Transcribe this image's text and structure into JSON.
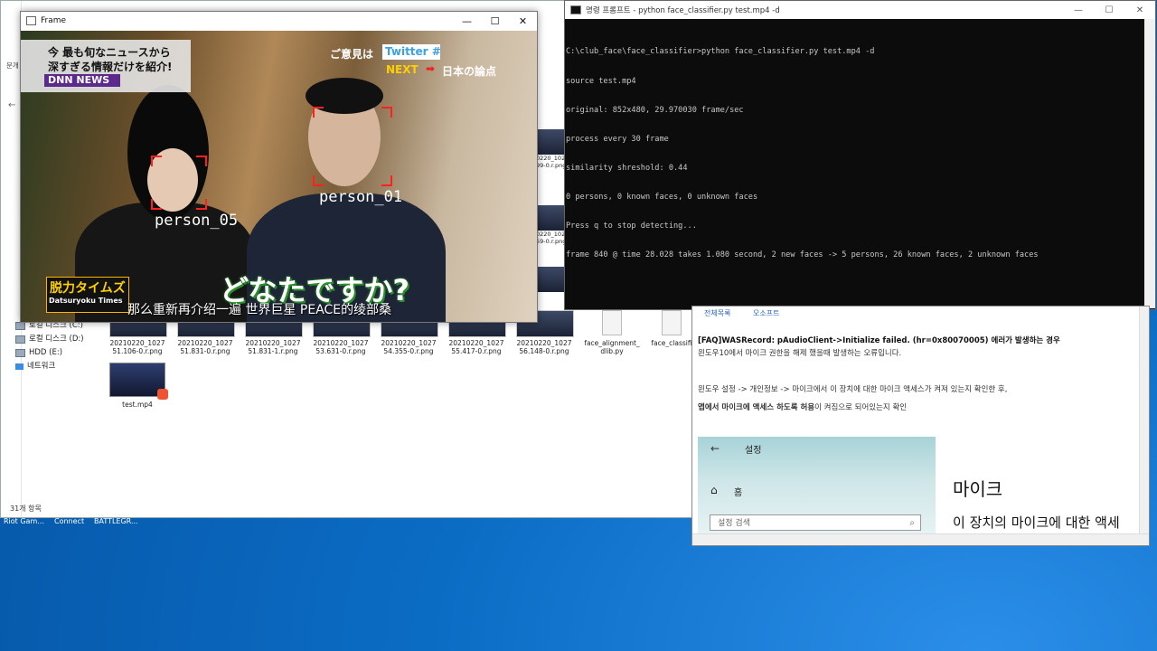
{
  "explorer": {
    "status": "31개 항목",
    "tree": [
      {
        "label": "로컬 디스크 (C:)",
        "icon": "drive-icon"
      },
      {
        "label": "로컬 디스크 (D:)",
        "icon": "drive-icon"
      },
      {
        "label": "HDD (E:)",
        "icon": "drive-icon"
      },
      {
        "label": "네트워크",
        "icon": "network-icon"
      }
    ],
    "files": [
      {
        "name": "20210220_1027\n51.106-0.r.png"
      },
      {
        "name": "20210220_1027\n51.831-0.r.png"
      },
      {
        "name": "20210220_1027\n51.831-1.r.png"
      },
      {
        "name": "20210220_1027\n53.631-0.r.png"
      },
      {
        "name": "20210220_1027\n54.355-0.r.png"
      },
      {
        "name": "20210220_1027\n55.417-0.r.png"
      },
      {
        "name": "20210220_1027\n56.148-0.r.png"
      },
      {
        "name": "face_alignment_\ndlib.py"
      },
      {
        "name": "face_classifi"
      }
    ],
    "video_file": "test.mp4",
    "side_labels": [
      "0220_102\n99-0.r.png",
      "0220_102\n59-0.r.png"
    ],
    "top_left_label": "문개",
    "taskbar": [
      "Riot Gam...",
      "Connect",
      "BATTLEGR..."
    ]
  },
  "frame_window": {
    "title": "Frame",
    "persons": [
      "person_05",
      "person_01"
    ],
    "overlay": {
      "top_left_1": "今 最も旬なニュースから",
      "top_left_2": "深すぎる情報だけを紹介!",
      "brand": "DNN NEWS",
      "opinion": "ご意見は",
      "twitter": "Twitter #",
      "next": "NEXT",
      "next_arrow": "➡",
      "next_text": "日本の論点",
      "logo": "脱力タイムズ",
      "logo_sub": "Datsuryoku Times",
      "caption": "どなたですか?",
      "subtitle": "那么重新再介绍一遍 世界巨星 PEACE的绫部桑"
    }
  },
  "cmd_window": {
    "title": "명령 프롬프트 - python  face_classifier.py test.mp4 -d",
    "lines": [
      "C:\\club_face\\face_classifier>python face_classifier.py test.mp4 -d",
      "source test.mp4",
      "original: 852x480, 29.970030 frame/sec",
      "process every 30 frame",
      "similarity shreshold: 0.44",
      "0 persons, 0 known faces, 0 unknown faces",
      "Press q to stop detecting...",
      "frame 840 @ time 28.028 takes 1.080 second, 2 new faces -> 5 persons, 26 known faces, 2 unknown faces"
    ]
  },
  "web_panel": {
    "tabs": [
      "전체목록",
      "오소프트"
    ],
    "heading": "[FAQ]WASRecord: pAudioClient->Initialize failed. (hr=0x80070005) 에러가 발생하는 경우",
    "line1": "윈도우10에서 마이크 권한을 해제 했을때 발생하는 오류입니다.",
    "line2": "윈도우 설정 -> 개인정보 -> 마이크에서 이 장치에 대한 마이크 액세스가 켜져 있는지 확인한 후,",
    "line3_bold": "앱에서 마이크에 액세스 하도록 허용",
    "line3_rest": "이 켜짐으로 되어있는지 확인",
    "settings": {
      "back": "←",
      "title": "설정",
      "home": "홈",
      "search_placeholder": "설정 검색",
      "mic_title": "마이크",
      "mic_desc": "이 장치의 마이크에 대한 액세"
    }
  }
}
